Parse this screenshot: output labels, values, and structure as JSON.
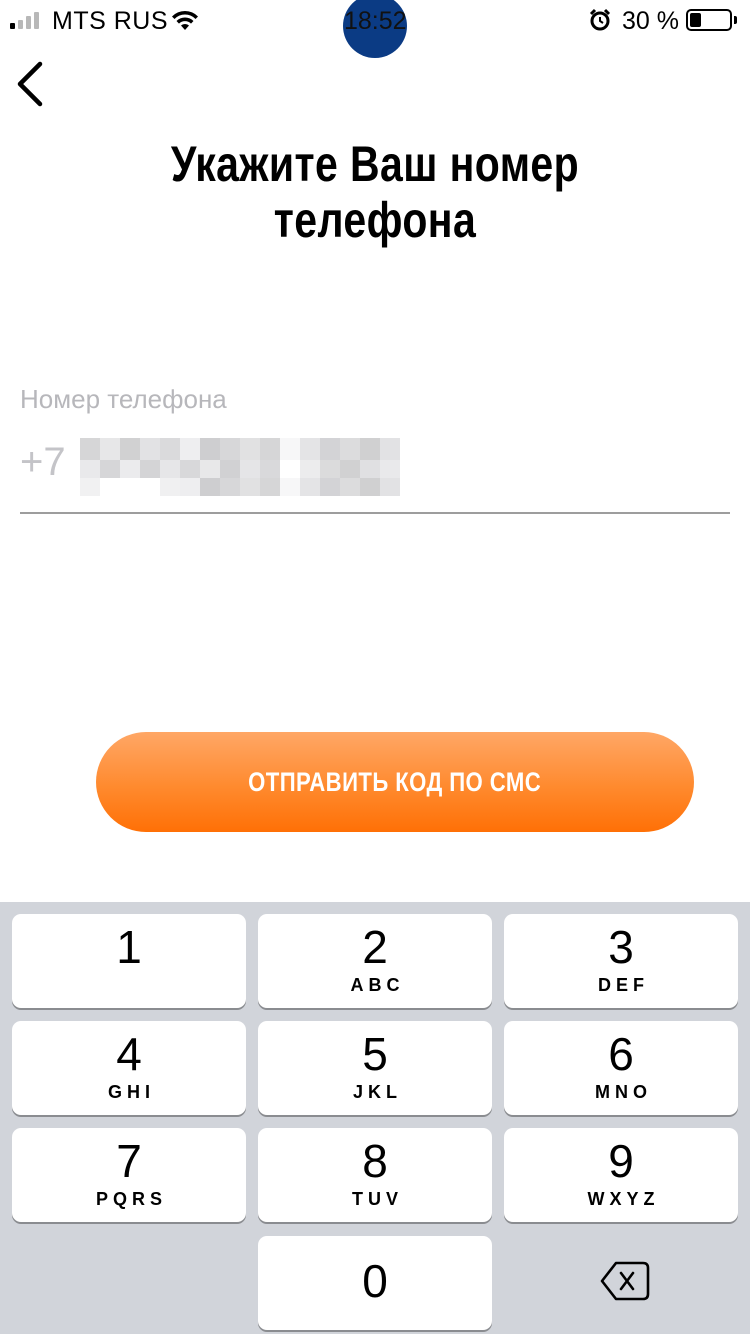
{
  "status_bar": {
    "carrier": "MTS RUS",
    "time": "18:52",
    "battery_percent": "30 %",
    "battery_level": 0.3
  },
  "header": {
    "back_icon": "chevron-left-icon",
    "title": "Укажите Ваш номер телефона"
  },
  "phone_field": {
    "label": "Номер телефона",
    "prefix": "+7",
    "value_blurred": true
  },
  "actions": {
    "send_code_label": "ОТПРАВИТЬ КОД ПО СМС",
    "button_color": "#ff7c1a"
  },
  "keypad": {
    "keys": [
      {
        "digit": "1",
        "letters": ""
      },
      {
        "digit": "2",
        "letters": "ABC"
      },
      {
        "digit": "3",
        "letters": "DEF"
      },
      {
        "digit": "4",
        "letters": "GHI"
      },
      {
        "digit": "5",
        "letters": "JKL"
      },
      {
        "digit": "6",
        "letters": "MNO"
      },
      {
        "digit": "7",
        "letters": "PQRS"
      },
      {
        "digit": "8",
        "letters": "TUV"
      },
      {
        "digit": "9",
        "letters": "WXYZ"
      },
      {
        "digit": "0",
        "letters": ""
      }
    ],
    "backspace_icon": "backspace-icon"
  }
}
